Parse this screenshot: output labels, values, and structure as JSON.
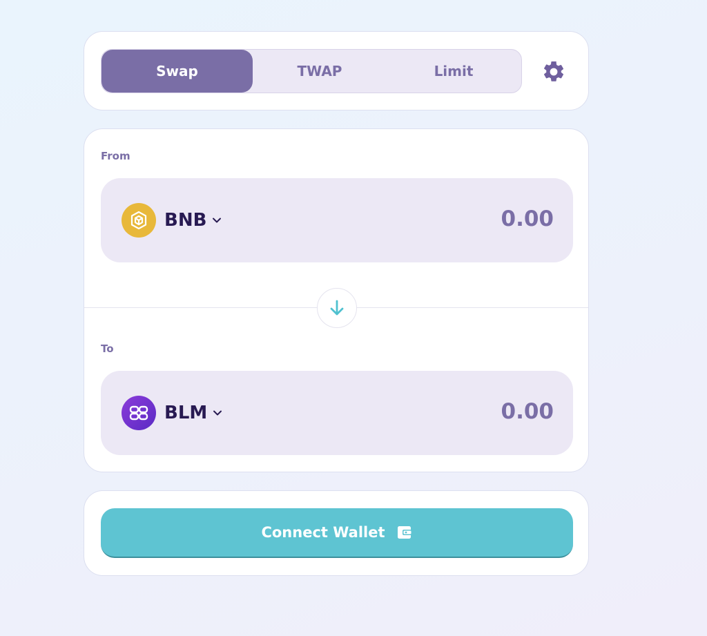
{
  "tabs": {
    "items": [
      {
        "label": "Swap",
        "active": true
      },
      {
        "label": "TWAP",
        "active": false
      },
      {
        "label": "Limit",
        "active": false
      }
    ],
    "settings_icon": "gear-icon"
  },
  "swap": {
    "from": {
      "label": "From",
      "token": {
        "symbol": "BNB",
        "icon": "bnb-token-icon",
        "color": "#E8B83A"
      },
      "amount": "0.00"
    },
    "flip_icon": "arrow-down-icon",
    "to": {
      "label": "To",
      "token": {
        "symbol": "BLM",
        "icon": "blm-token-icon",
        "color": "#7B35D4"
      },
      "amount": "0.00"
    }
  },
  "wallet": {
    "connect_label": "Connect Wallet",
    "icon": "wallet-icon"
  },
  "colors": {
    "accent": "#7A6EA6",
    "button": "#5EC4D2",
    "token_text": "#281A52",
    "box_bg": "#ECE8F5"
  }
}
